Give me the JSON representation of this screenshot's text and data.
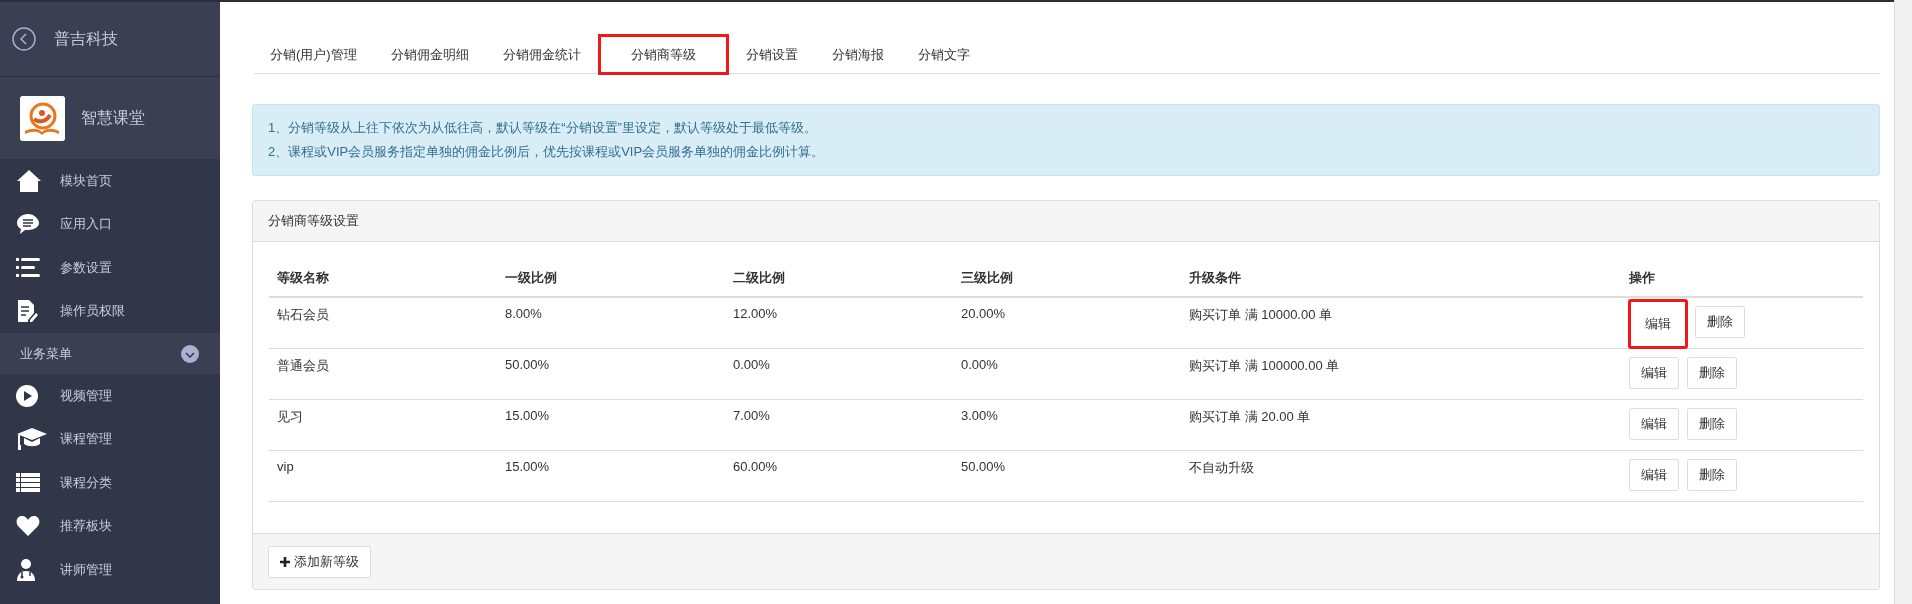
{
  "sidebar": {
    "title": "普吉科技",
    "app_name": "智慧课堂",
    "items": [
      {
        "label": "模块首页",
        "kind": "home"
      },
      {
        "label": "应用入口",
        "kind": "chat"
      },
      {
        "label": "参数设置",
        "kind": "list"
      },
      {
        "label": "操作员权限",
        "kind": "doc"
      }
    ],
    "section": {
      "label": "业务菜单",
      "expanded": true
    },
    "section_items": [
      {
        "label": "视频管理",
        "kind": "play"
      },
      {
        "label": "课程管理",
        "kind": "cap"
      },
      {
        "label": "课程分类",
        "kind": "rows"
      },
      {
        "label": "推荐板块",
        "kind": "heart"
      },
      {
        "label": "讲师管理",
        "kind": "doctor"
      }
    ]
  },
  "tabs": [
    {
      "label": "分销(用户)管理",
      "selected": false,
      "highlighted": false
    },
    {
      "label": "分销佣金明细",
      "selected": false,
      "highlighted": false
    },
    {
      "label": "分销佣金统计",
      "selected": false,
      "highlighted": false
    },
    {
      "label": "分销商等级",
      "selected": true,
      "highlighted": true
    },
    {
      "label": "分销设置",
      "selected": false,
      "highlighted": false
    },
    {
      "label": "分销海报",
      "selected": false,
      "highlighted": false
    },
    {
      "label": "分销文字",
      "selected": false,
      "highlighted": false
    }
  ],
  "notice": [
    "1、分销等级从上往下依次为从低往高，默认等级在“分销设置”里设定，默认等级处于最低等级。",
    "2、课程或VIP会员服务指定单独的佣金比例后，优先按课程或VIP会员服务单独的佣金比例计算。"
  ],
  "panel": {
    "title": "分销商等级设置",
    "columns": [
      "等级名称",
      "一级比例",
      "二级比例",
      "三级比例",
      "升级条件",
      "操作"
    ],
    "rows": [
      {
        "cells": [
          "钻石会员",
          "8.00%",
          "12.00%",
          "20.00%",
          "购买订单 满 10000.00 单"
        ],
        "actions": [
          {
            "label": "编辑",
            "highlighted": true
          },
          {
            "label": "删除",
            "highlighted": false
          }
        ]
      },
      {
        "cells": [
          "普通会员",
          "50.00%",
          "0.00%",
          "0.00%",
          "购买订单 满 100000.00 单"
        ],
        "actions": [
          {
            "label": "编辑",
            "highlighted": false
          },
          {
            "label": "删除",
            "highlighted": false
          }
        ]
      },
      {
        "cells": [
          "见习",
          "15.00%",
          "7.00%",
          "3.00%",
          "购买订单 满 20.00 单"
        ],
        "actions": [
          {
            "label": "编辑",
            "highlighted": false
          },
          {
            "label": "删除",
            "highlighted": false
          }
        ]
      },
      {
        "cells": [
          "vip",
          "15.00%",
          "60.00%",
          "50.00%",
          "不自动升级"
        ],
        "actions": [
          {
            "label": "编辑",
            "highlighted": false
          },
          {
            "label": "删除",
            "highlighted": false
          }
        ]
      }
    ],
    "add_button": "添加新等级"
  }
}
